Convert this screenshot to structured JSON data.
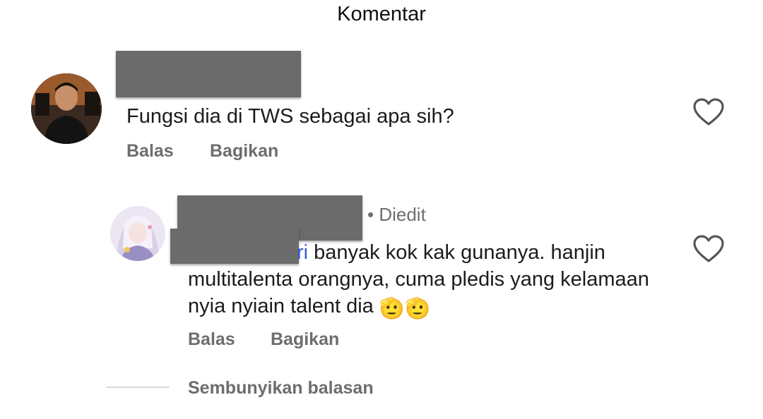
{
  "header": {
    "title": "Komentar"
  },
  "comments": [
    {
      "text": "Fungsi dia di TWS sebagai apa sih?",
      "reply_label": "Balas",
      "share_label": "Bagikan"
    },
    {
      "edited_label": "• Diedit",
      "mention_tail": "ri",
      "text": " banyak kok kak gunanya. hanjin multitalenta orangnya, cuma pledis yang kelamaan nyia nyiain talent dia ",
      "emoji": "🫡🫡",
      "reply_label": "Balas",
      "share_label": "Bagikan"
    }
  ],
  "thread": {
    "hide_replies_label": "Sembunyikan balasan"
  },
  "icons": {
    "like": "heart-outline-icon"
  }
}
